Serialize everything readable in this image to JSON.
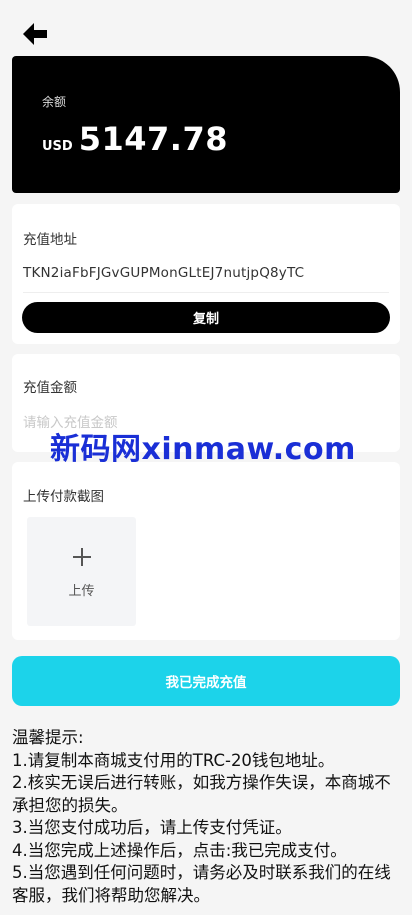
{
  "balance": {
    "label": "余额",
    "currency": "USD",
    "amount": "5147.78"
  },
  "address": {
    "title": "充值地址",
    "value": "TKN2iaFbFJGvGUPMonGLtEJ7nutjpQ8yTC",
    "copy_label": "复制"
  },
  "recharge_amount": {
    "title": "充值金额",
    "placeholder": "请输入充值金额"
  },
  "watermark": "新码网xinmaw.com",
  "upload": {
    "title": "上传付款截图",
    "button_label": "上传"
  },
  "submit_label": "我已完成充值",
  "tips": {
    "heading": "温馨提示:",
    "items": [
      "1.请复制本商城支付用的TRC-20钱包地址。",
      "2.核实无误后进行转账，如我方操作失误，本商城不承担您的损失。",
      "3.当您支付成功后，请上传支付凭证。",
      "4.当您完成上述操作后，点击:我已完成支付。",
      "5.当您遇到任何问题时，请务必及时联系我们的在线客服，我们将帮助您解决。"
    ]
  },
  "colors": {
    "accent": "#1cd3ea",
    "card_dark": "#000000",
    "watermark": "#1a2fd6"
  }
}
